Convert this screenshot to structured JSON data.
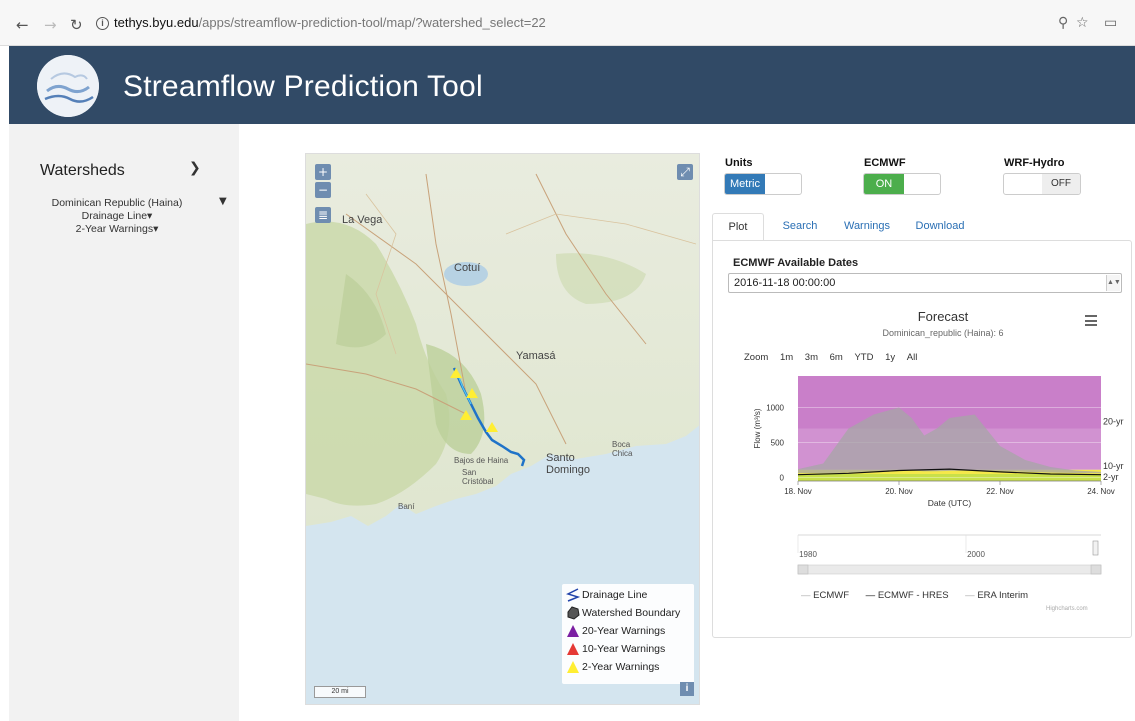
{
  "browser": {
    "url_host": "tethys.byu.edu",
    "url_path": "/apps/streamflow-prediction-tool/map/?watershed_select=22"
  },
  "app": {
    "title": "Streamflow Prediction Tool"
  },
  "sidebar": {
    "heading": "Watersheds",
    "watershed": "Dominican Republic (Haina)",
    "layers": [
      "Drainage Line",
      "2-Year Warnings"
    ]
  },
  "map": {
    "labels": {
      "la_vega": "La Vega",
      "cotui": "Cotuí",
      "santo_domingo": "Santo Domingo",
      "bajos_de_haina": "Bajos de Haina",
      "san_cristobal": "San Cristóbal",
      "bani": "Baní",
      "yamasa": "Yamasá",
      "boca_chica": "Boca Chica"
    },
    "legend": [
      {
        "label": "Drainage Line",
        "color": "#2244aa"
      },
      {
        "label": "Watershed Boundary",
        "color": "#555555"
      },
      {
        "label": "20-Year Warnings",
        "color": "#7b1fa2"
      },
      {
        "label": "10-Year Warnings",
        "color": "#e53935"
      },
      {
        "label": "2-Year Warnings",
        "color": "#ffee33"
      }
    ],
    "scale": "20 mi"
  },
  "controls": {
    "units": {
      "label": "Units",
      "value": "Metric",
      "color": "#337ab7"
    },
    "ecmwf": {
      "label": "ECMWF",
      "value": "ON",
      "color": "#4cae4c"
    },
    "wrf": {
      "label": "WRF-Hydro",
      "value": "OFF"
    }
  },
  "tabs": [
    "Plot",
    "Search",
    "Warnings",
    "Download"
  ],
  "plot": {
    "dates_label": "ECMWF Available Dates",
    "selected_date": "2016-11-18 00:00:00",
    "zoom_label": "Zoom",
    "zoom_options": [
      "1m",
      "3m",
      "6m",
      "YTD",
      "1y",
      "All"
    ],
    "legend": [
      "ECMWF",
      "ECMWF - HRES",
      "ERA Interim"
    ],
    "credits": "Highcharts.com"
  },
  "chart_data": {
    "type": "area",
    "title": "Forecast",
    "subtitle": "Dominican_republic (Haina): 6",
    "xlabel": "Date (UTC)",
    "ylabel": "Flow (m³/s)",
    "x_ticks": [
      "18. Nov",
      "20. Nov",
      "22. Nov",
      "24. Nov"
    ],
    "y_ticks": [
      0,
      500,
      1000
    ],
    "ylim": [
      -50,
      1450
    ],
    "return_periods": [
      {
        "label": "20-yr",
        "value": 700,
        "color": "#c97fc9"
      },
      {
        "label": "10-yr",
        "value": 110,
        "color": "#f5e84a"
      },
      {
        "label": "2-yr",
        "value": 50,
        "color": "#c8e04a"
      }
    ],
    "ensemble_range": {
      "x": [
        0,
        0.5,
        1,
        1.5,
        2,
        2.25,
        2.5,
        2.75,
        3,
        3.5,
        4,
        4.5,
        5,
        5.5,
        6
      ],
      "high": [
        120,
        200,
        700,
        900,
        1000,
        850,
        600,
        700,
        850,
        900,
        450,
        250,
        150,
        100,
        80
      ],
      "low": [
        60,
        60,
        70,
        90,
        100,
        100,
        90,
        90,
        95,
        100,
        90,
        80,
        70,
        65,
        60
      ]
    },
    "hres": {
      "x": [
        0,
        1,
        2,
        3,
        4,
        5,
        6
      ],
      "y": [
        40,
        60,
        100,
        120,
        80,
        50,
        40
      ]
    },
    "navigator_ticks": [
      "1980",
      "2000"
    ]
  }
}
